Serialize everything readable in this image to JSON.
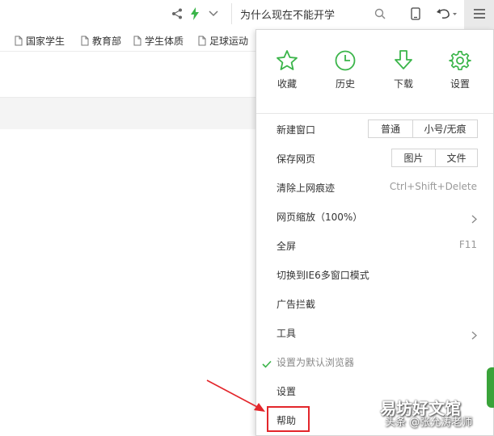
{
  "toolbar": {
    "address_text": "为什么现在不能开学",
    "icons": [
      "share-icon",
      "lightning-icon",
      "chevron-down-icon",
      "search-icon",
      "tablet-icon",
      "undo-icon",
      "menu-icon"
    ]
  },
  "bookmarks": [
    {
      "label": "国家学生"
    },
    {
      "label": "教育部"
    },
    {
      "label": "学生体质"
    },
    {
      "label": "足球运动"
    }
  ],
  "menu": {
    "quick": [
      {
        "label": "收藏",
        "icon": "star-icon"
      },
      {
        "label": "历史",
        "icon": "clock-icon"
      },
      {
        "label": "下载",
        "icon": "download-icon"
      },
      {
        "label": "设置",
        "icon": "gear-icon"
      }
    ],
    "items": {
      "new_window": {
        "label": "新建窗口",
        "opt1": "普通",
        "opt2": "小号/无痕"
      },
      "save_page": {
        "label": "保存网页",
        "opt1": "图片",
        "opt2": "文件"
      },
      "clear_traces": {
        "label": "清除上网痕迹",
        "shortcut": "Ctrl+Shift+Delete"
      },
      "zoom": {
        "label": "网页缩放（100%）"
      },
      "fullscreen": {
        "label": "全屏",
        "shortcut": "F11"
      },
      "ie6_mode": {
        "label": "切换到IE6多窗口模式"
      },
      "ad_block": {
        "label": "广告拦截"
      },
      "tools": {
        "label": "工具"
      },
      "default_browser": {
        "label": "设置为默认浏览器"
      },
      "settings": {
        "label": "设置"
      },
      "help": {
        "label": "帮助"
      }
    }
  },
  "watermark": {
    "line1": "易坊好文馆",
    "line2": "头条 @张允涛老师"
  },
  "colors": {
    "accent_green": "#3bb54a",
    "highlight_red": "#e3262b"
  }
}
